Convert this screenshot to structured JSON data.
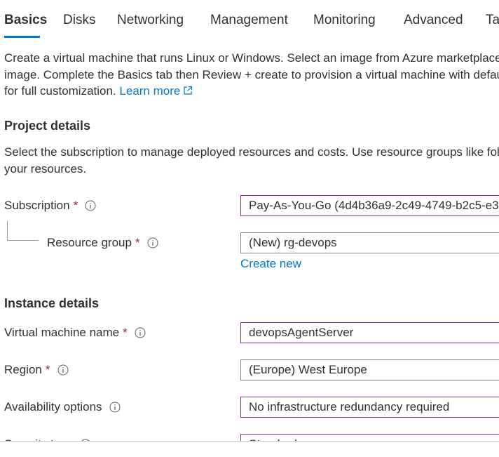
{
  "tabs": [
    {
      "label": "Basics"
    },
    {
      "label": "Disks"
    },
    {
      "label": "Networking"
    },
    {
      "label": "Management"
    },
    {
      "label": "Monitoring"
    },
    {
      "label": "Advanced"
    },
    {
      "label": "Tags"
    }
  ],
  "intro": {
    "line1": "Create a virtual machine that runs Linux or Windows. Select an image from Azure marketplace",
    "line2": "image. Complete the Basics tab then Review + create to provision a virtual machine with default",
    "line3_prefix": "for full customization. ",
    "learn_more": "Learn more"
  },
  "project_details": {
    "title": "Project details",
    "desc_line1": "Select the subscription to manage deployed resources and costs. Use resource groups like folders",
    "desc_line2": "your resources.",
    "subscription_label": "Subscription",
    "subscription_value": "Pay-As-You-Go (4d4b36a9-2c49-4749-b2c5-e3",
    "resource_group_label": "Resource group",
    "resource_group_value": "(New) rg-devops",
    "create_new": "Create new"
  },
  "instance_details": {
    "title": "Instance details",
    "vm_name_label": "Virtual machine name",
    "vm_name_value": "devopsAgentServer",
    "region_label": "Region",
    "region_value": "(Europe) West Europe",
    "availability_label": "Availability options",
    "availability_value": "No infrastructure redundancy required",
    "security_label": "Security type",
    "security_value": "Standard"
  },
  "required_marker": "*",
  "colors": {
    "accent": "#0078d4",
    "input_border": "#8a2da5",
    "required": "#a4262c"
  }
}
